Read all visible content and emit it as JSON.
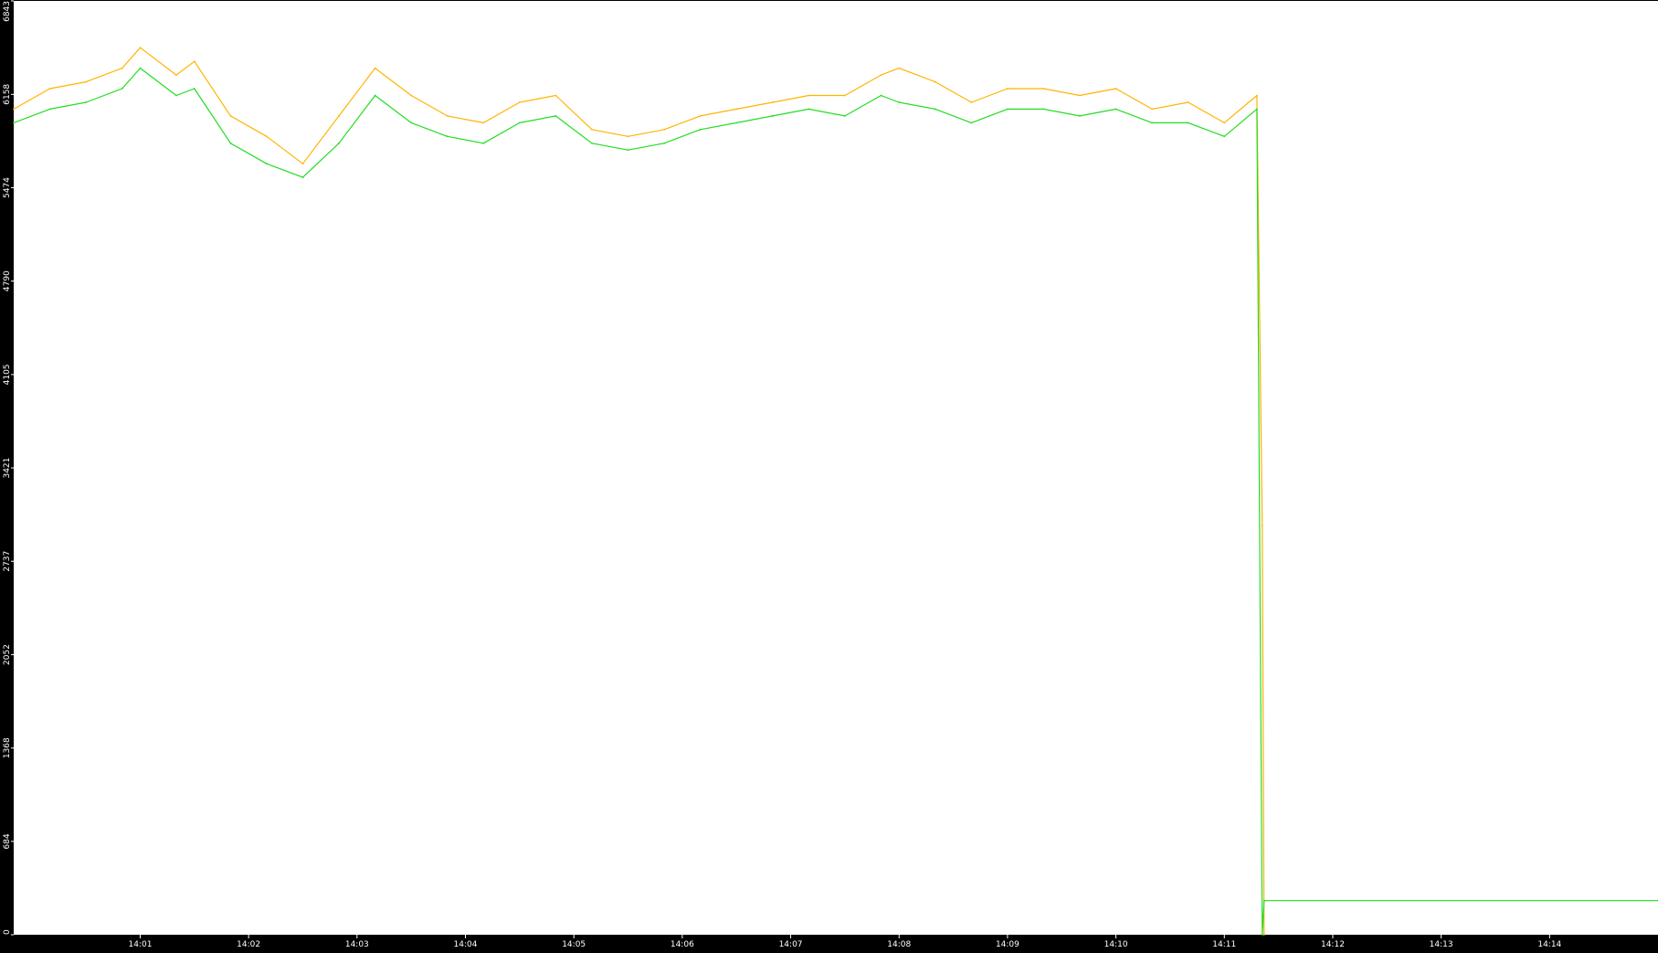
{
  "chart_data": {
    "type": "line",
    "title": "",
    "xlabel": "",
    "ylabel": "",
    "ylim": [
      0,
      6843
    ],
    "xlim": [
      "13:59:50",
      "14:15:00"
    ],
    "grid": false,
    "legend": "none",
    "background_color": "#000000",
    "plot_background_color": "#ffffff",
    "y_ticks": [
      "0",
      "684",
      "1368",
      "2052",
      "2737",
      "3421",
      "4105",
      "4790",
      "5474",
      "6158",
      "6843"
    ],
    "y_tick_values": [
      0,
      684,
      1368,
      2052,
      2737,
      3421,
      4105,
      4790,
      5474,
      6158,
      6843
    ],
    "x_ticks": [
      "14:01",
      "14:02",
      "14:03",
      "14:04",
      "14:05",
      "14:06",
      "14:07",
      "14:08",
      "14:09",
      "14:10",
      "14:11",
      "14:12",
      "14:13",
      "14:14"
    ],
    "series": [
      {
        "color": "#ffb400",
        "x": [
          "13:59:50",
          "14:00:10",
          "14:00:30",
          "14:00:50",
          "14:01:00",
          "14:01:20",
          "14:01:30",
          "14:01:50",
          "14:02:10",
          "14:02:30",
          "14:02:50",
          "14:03:10",
          "14:03:30",
          "14:03:50",
          "14:04:10",
          "14:04:30",
          "14:04:50",
          "14:05:10",
          "14:05:30",
          "14:05:50",
          "14:06:10",
          "14:06:30",
          "14:06:50",
          "14:07:10",
          "14:07:30",
          "14:07:50",
          "14:08:00",
          "14:08:20",
          "14:08:40",
          "14:09:00",
          "14:09:20",
          "14:09:40",
          "14:10:00",
          "14:10:20",
          "14:10:40",
          "14:11:00",
          "14:11:18",
          "14:11:21",
          "14:11:22"
        ],
        "values": [
          6050,
          6200,
          6250,
          6350,
          6500,
          6300,
          6400,
          6000,
          5850,
          5650,
          6000,
          6350,
          6150,
          6000,
          5950,
          6100,
          6150,
          5900,
          5850,
          5900,
          6000,
          6050,
          6100,
          6150,
          6150,
          6300,
          6350,
          6250,
          6100,
          6200,
          6200,
          6150,
          6200,
          6050,
          6100,
          5950,
          6150,
          3000,
          0
        ]
      },
      {
        "color": "#22dd22",
        "x": [
          "13:59:50",
          "14:00:10",
          "14:00:30",
          "14:00:50",
          "14:01:00",
          "14:01:20",
          "14:01:30",
          "14:01:50",
          "14:02:10",
          "14:02:30",
          "14:02:50",
          "14:03:10",
          "14:03:30",
          "14:03:50",
          "14:04:10",
          "14:04:30",
          "14:04:50",
          "14:05:10",
          "14:05:30",
          "14:05:50",
          "14:06:10",
          "14:06:30",
          "14:06:50",
          "14:07:10",
          "14:07:30",
          "14:07:50",
          "14:08:00",
          "14:08:20",
          "14:08:40",
          "14:09:00",
          "14:09:20",
          "14:09:40",
          "14:10:00",
          "14:10:20",
          "14:10:40",
          "14:11:00",
          "14:11:18",
          "14:11:21",
          "14:11:22",
          "14:15:00"
        ],
        "values": [
          5950,
          6050,
          6100,
          6200,
          6350,
          6150,
          6200,
          5800,
          5650,
          5550,
          5800,
          6150,
          5950,
          5850,
          5800,
          5950,
          6000,
          5800,
          5750,
          5800,
          5900,
          5950,
          6000,
          6050,
          6000,
          6150,
          6100,
          6050,
          5950,
          6050,
          6050,
          6000,
          6050,
          5950,
          5950,
          5850,
          6050,
          0,
          250,
          250
        ]
      }
    ]
  }
}
